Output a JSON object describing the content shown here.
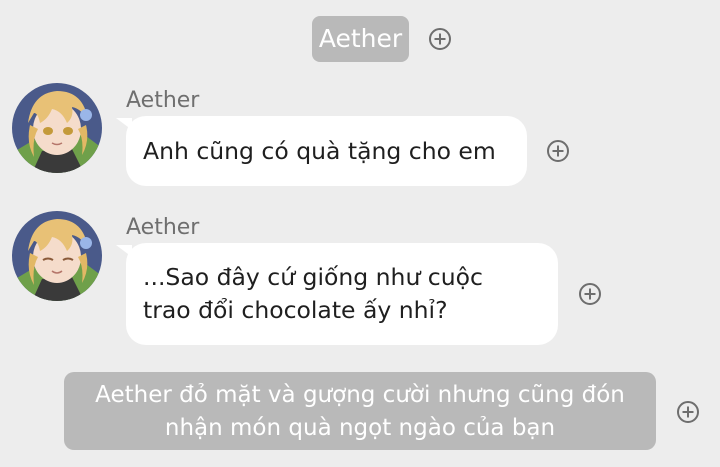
{
  "header": {
    "speaker_label": "Aether"
  },
  "messages": [
    {
      "sender": "Aether",
      "text": "Anh cũng có quà tặng cho em"
    },
    {
      "sender": "Aether",
      "lines": [
        "...Sao đây cứ giống như cuộc",
        "trao đổi chocolate ấy nhỉ?"
      ]
    }
  ],
  "narration": {
    "lines": [
      "Aether đỏ mặt và gượng cười nhưng cũng đón",
      "nhận món quà ngọt ngào của bạn"
    ]
  },
  "colors": {
    "background": "#ededed",
    "chip": "#b9b9b9",
    "bubble": "#ffffff",
    "icon": "#6e6e6e"
  },
  "icons": {
    "add": "plus-circle-icon",
    "avatar": "character-avatar"
  }
}
